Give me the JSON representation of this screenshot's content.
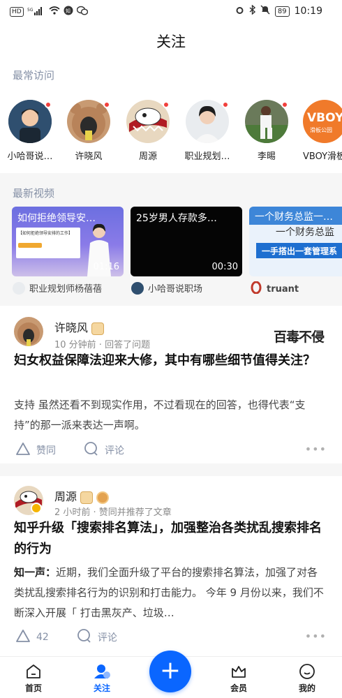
{
  "status_bar": {
    "network": "HD",
    "signal": "5G",
    "chip1": "HD",
    "battery": "89",
    "time": "10:19"
  },
  "header": {
    "title": "关注"
  },
  "frequent": {
    "label": "最常访问",
    "items": [
      {
        "name": "小哈哥说…"
      },
      {
        "name": "许晓风"
      },
      {
        "name": "周源"
      },
      {
        "name": "职业规划…"
      },
      {
        "name": "李晹"
      },
      {
        "name": "VBOY滑板"
      }
    ],
    "vboy_logo": "VBOY",
    "vboy_sub": "滑板公园"
  },
  "videos": {
    "label": "最新视频",
    "items": [
      {
        "title": "如何拒绝领导安…",
        "subtitle": "【如何拒绝领导安排的工作】",
        "duration": "01:16",
        "author": "职业规划师杨蓓蓓"
      },
      {
        "title": "25岁男人存款多…",
        "duration": "00:30",
        "author": "小哈哥说职场"
      },
      {
        "title": "一个财务总监一…",
        "subtitle": "一个财务总监",
        "banner": "一手搭出一套管理系",
        "author": "truant"
      }
    ]
  },
  "feed": [
    {
      "author": "许晓风",
      "meta": "10 分钟前 · 回答了问题",
      "logo": "百毒不侵",
      "title": "妇女权益保障法迎来大修，其中有哪些细节值得关注？",
      "excerpt": "支持 虽然还看不到现实作用，不过看现在的回答，也得代表“支持”的那一派来表达一声啊。",
      "like_label": "赞同",
      "comment_label": "评论"
    },
    {
      "author": "周源",
      "meta": "2 小时前 · 赞同并推荐了文章",
      "title": "知乎升级「搜索排名算法」，加强整治各类扰乱搜索排名的行为",
      "excerpt_prefix": "知一声：",
      "excerpt": "近期，我们全面升级了平台的搜索排名算法，加强了对各类扰乱搜索排名行为的识别和打击能力。 今年 9 月份以来，我们不断深入开展「 打击黑灰产、垃圾…",
      "like_count": "42",
      "comment_label": "评论"
    }
  ],
  "bottom_nav": {
    "home": "首页",
    "follow": "关注",
    "member": "会员",
    "mine": "我的",
    "fab": "+"
  },
  "colors": {
    "accent": "#0a66ff",
    "notif": "#f1403c",
    "muted": "#8590a6"
  }
}
